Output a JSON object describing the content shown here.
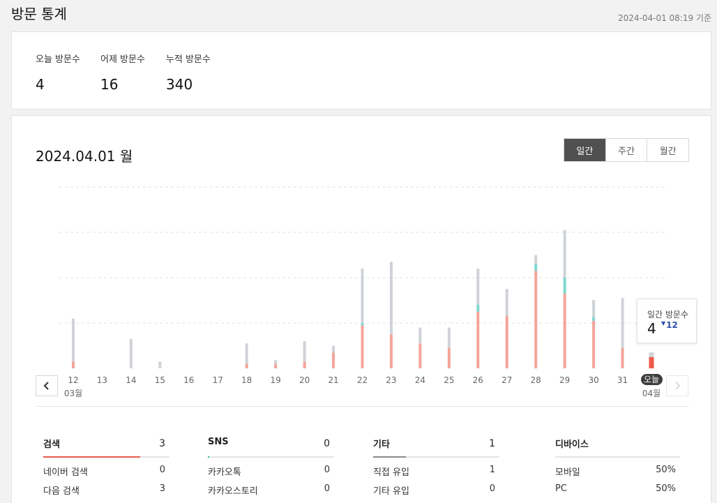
{
  "header": {
    "title": "방문 통계",
    "updated": "2024-04-01 08:19 기준"
  },
  "summary": [
    {
      "label": "오늘 방문수",
      "value": "4"
    },
    {
      "label": "어제 방문수",
      "value": "16"
    },
    {
      "label": "누적 방문수",
      "value": "340"
    }
  ],
  "main": {
    "date_title": "2024.04.01 월",
    "tabs": [
      {
        "label": "일간",
        "active": true
      },
      {
        "label": "주간",
        "active": false
      },
      {
        "label": "월간",
        "active": false
      }
    ]
  },
  "nav": {
    "prev_icon": "chevron-left-icon",
    "next_icon": "chevron-right-icon"
  },
  "colors": {
    "search": "#f4a49a",
    "sns": "#7fd8cf",
    "other": "#cfd3d8",
    "today": "#ee5a4a",
    "grid": "#e2e2e2",
    "delta": "#2d4fa8"
  },
  "chart_data": {
    "type": "bar",
    "stacked": true,
    "categories": [
      "12",
      "13",
      "14",
      "15",
      "16",
      "17",
      "18",
      "19",
      "20",
      "21",
      "22",
      "23",
      "24",
      "25",
      "26",
      "27",
      "28",
      "29",
      "30",
      "31",
      "오늘"
    ],
    "month_labels": {
      "0": "03월",
      "20": "04월"
    },
    "series": [
      {
        "key": "search",
        "values": [
          1.5,
          0,
          0,
          0,
          0,
          0,
          1,
          1,
          1.5,
          3.5,
          9.5,
          7.5,
          5.5,
          4.5,
          12.5,
          11.5,
          21.5,
          16.5,
          10.5,
          4.5,
          2.5
        ]
      },
      {
        "key": "sns",
        "values": [
          0,
          0,
          0,
          0,
          0,
          0,
          0,
          0,
          0,
          0,
          0.5,
          0,
          0,
          0,
          1.5,
          0,
          1.5,
          3.5,
          0.8,
          0,
          0
        ]
      },
      {
        "key": "other",
        "values": [
          9.5,
          0,
          6.5,
          1.5,
          0,
          0,
          4.5,
          0.8,
          4.5,
          1.5,
          12,
          16,
          3.5,
          4.5,
          8,
          6,
          2,
          10.5,
          3.8,
          11,
          1
        ]
      }
    ],
    "highlight_index": 20,
    "ylim": [
      0,
      40
    ],
    "gridlines": [
      10,
      20,
      30,
      40
    ],
    "tooltip": {
      "label": "일간 방문수",
      "value": "4",
      "delta": "12",
      "delta_direction": "down"
    }
  },
  "breakdown": [
    {
      "title": "검색",
      "total": "3",
      "share": 0.77,
      "bar_color": "#e85a4a",
      "rows": [
        {
          "label": "네이버 검색",
          "value": "0"
        },
        {
          "label": "다음 검색",
          "value": "3"
        }
      ]
    },
    {
      "title": "SNS",
      "total": "0",
      "share": 0.01,
      "bar_color": "#2bbfae",
      "rows": [
        {
          "label": "카카오톡",
          "value": "0"
        },
        {
          "label": "카카오스토리",
          "value": "0"
        }
      ]
    },
    {
      "title": "기타",
      "total": "1",
      "share": 0.26,
      "bar_color": "#8a8a8a",
      "rows": [
        {
          "label": "직접 유입",
          "value": "1"
        },
        {
          "label": "기타 유입",
          "value": "0"
        }
      ]
    },
    {
      "title": "디바이스",
      "total": "",
      "share": 0,
      "bar_color": "#8a8a8a",
      "rows": [
        {
          "label": "모바일",
          "value": "50%"
        },
        {
          "label": "PC",
          "value": "50%"
        }
      ]
    }
  ]
}
